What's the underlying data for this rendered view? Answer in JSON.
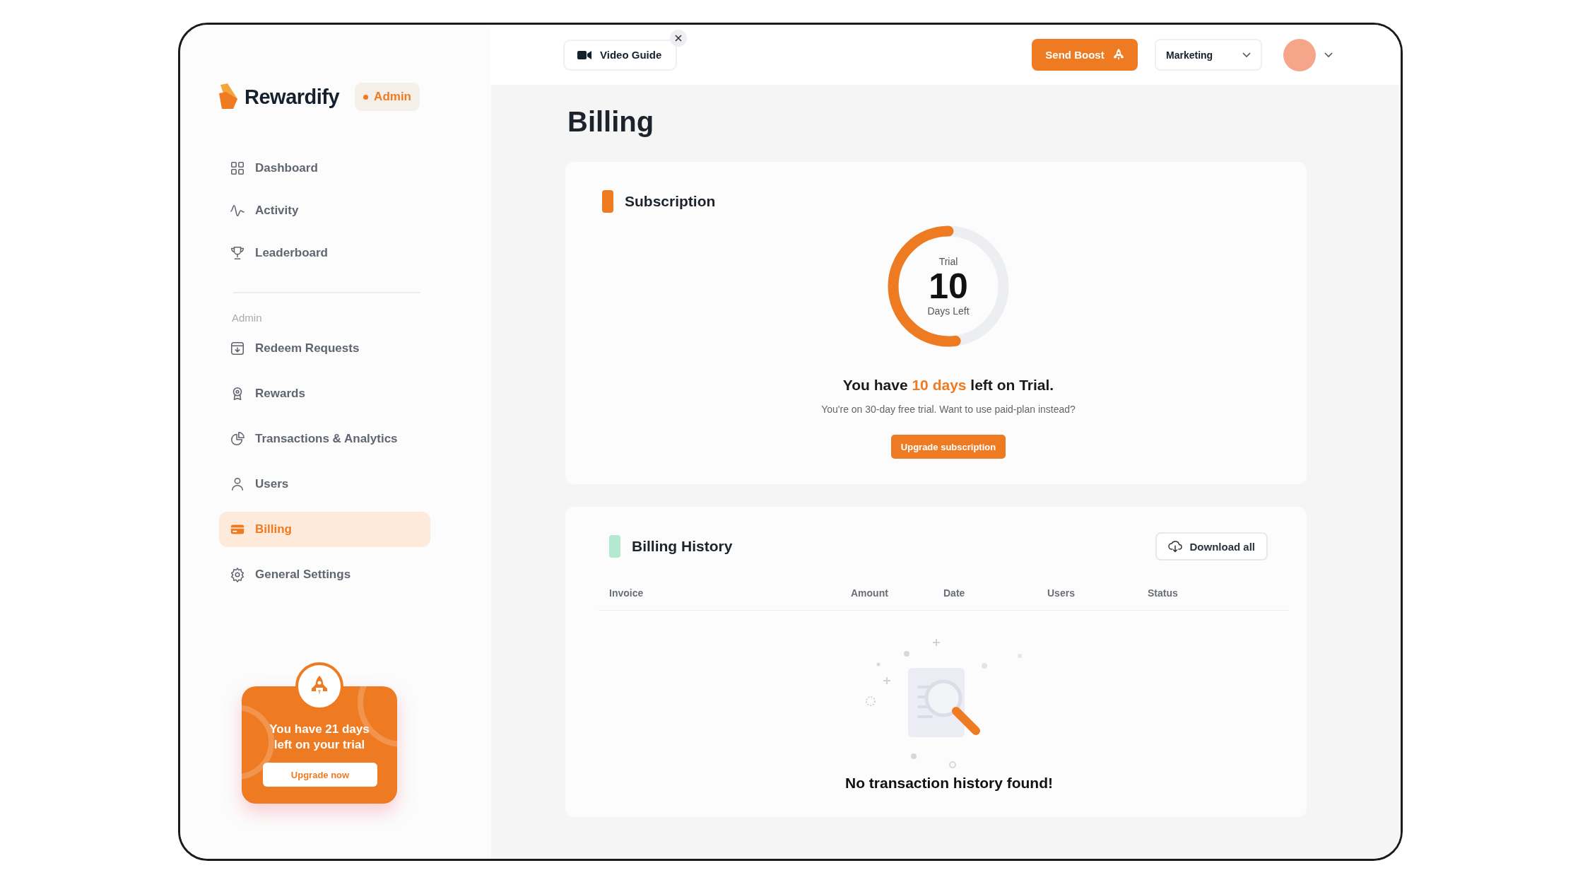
{
  "brand": {
    "name": "Rewardify",
    "role_badge": "Admin"
  },
  "sidebar": {
    "items": [
      {
        "label": "Dashboard",
        "selected": false
      },
      {
        "label": "Activity",
        "selected": false
      },
      {
        "label": "Leaderboard",
        "selected": false
      }
    ],
    "section_label": "Admin",
    "admin_items": [
      {
        "label": "Redeem Requests",
        "selected": false
      },
      {
        "label": "Rewards",
        "selected": false
      },
      {
        "label": "Transactions & Analytics",
        "selected": false
      },
      {
        "label": "Users",
        "selected": false
      },
      {
        "label": "Billing",
        "selected": true
      },
      {
        "label": "General Settings",
        "selected": false
      }
    ]
  },
  "promo": {
    "text": "You have 21 days left on your trial",
    "button": "Upgrade now"
  },
  "topbar": {
    "video_guide": "Video Guide",
    "send_boost": "Send Boost",
    "team_select": {
      "value": "Marketing"
    }
  },
  "page_title": "Billing",
  "subscription": {
    "title": "Subscription",
    "ring": {
      "top": "Trial",
      "number": "10",
      "bottom": "Days Left",
      "level": 0.52
    },
    "headline": {
      "before": "You have",
      "highlight": "10 days",
      "after": "left on Trial."
    },
    "note": "You're on 30-day free trial. Want to use paid-plan instead?",
    "button": "Upgrade subscription"
  },
  "billing_history": {
    "title": "Billing History",
    "download_button": "Download all",
    "columns": [
      "Invoice",
      "Amount",
      "Date",
      "Users",
      "Status"
    ],
    "empty_message": "No transaction history found!"
  }
}
